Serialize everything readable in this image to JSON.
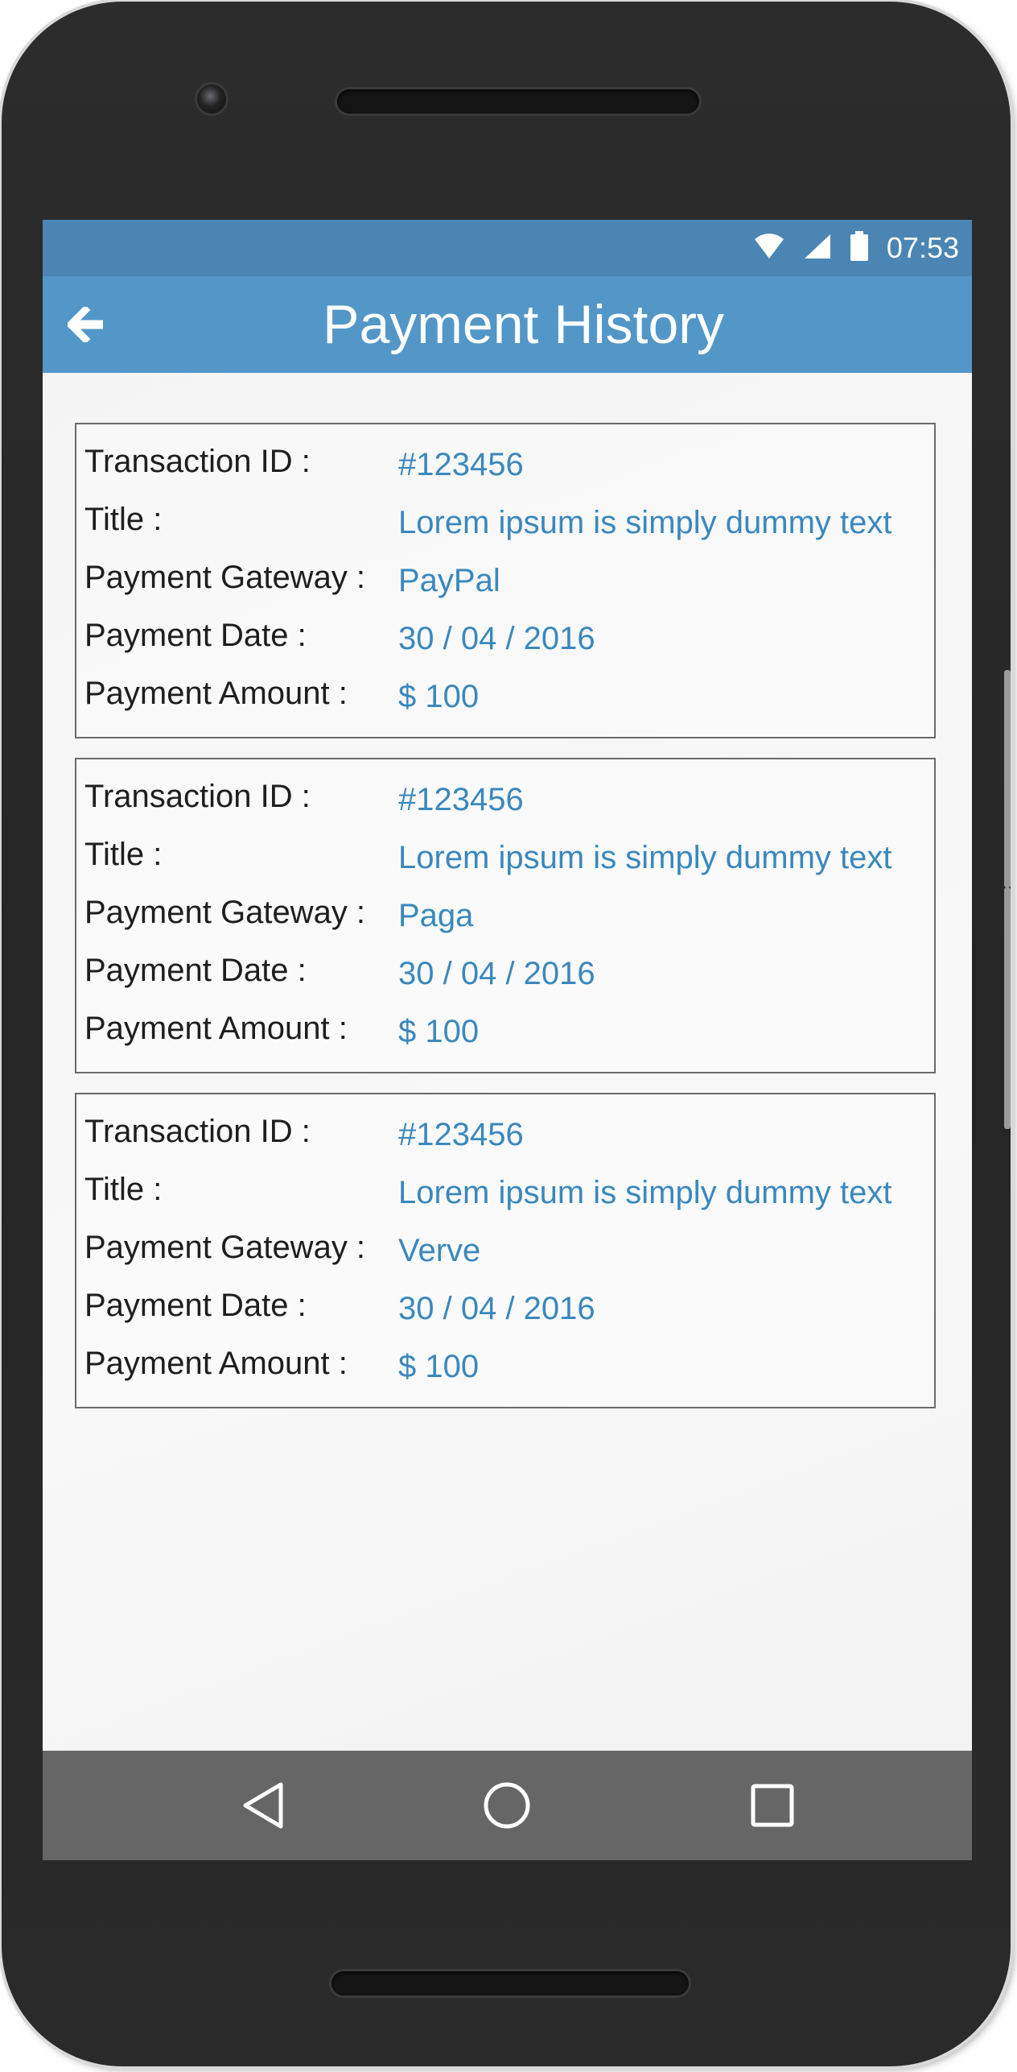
{
  "status_bar": {
    "time": "07:53",
    "icons": [
      "wifi-icon",
      "signal-icon",
      "battery-icon"
    ]
  },
  "app_bar": {
    "title": "Payment History",
    "back_icon": "arrow-back-icon"
  },
  "colors": {
    "status_bar": "#4a85b3",
    "app_bar": "#5297c7",
    "value_text": "#3a88bd",
    "nav_bar": "#666666"
  },
  "labels": {
    "transaction_id": "Transaction ID :",
    "title": "Title :",
    "gateway": "Payment Gateway :",
    "date": "Payment Date :",
    "amount": "Payment Amount :"
  },
  "payments": [
    {
      "transaction_id": "#123456",
      "title": "Lorem ipsum is simply dummy text",
      "gateway": "PayPal",
      "date": "30 / 04 / 2016",
      "amount": "$ 100"
    },
    {
      "transaction_id": "#123456",
      "title": "Lorem ipsum is simply dummy text",
      "gateway": "Paga",
      "date": "30 / 04 / 2016",
      "amount": "$ 100"
    },
    {
      "transaction_id": "#123456",
      "title": "Lorem ipsum is simply dummy text",
      "gateway": "Verve",
      "date": "30 / 04 / 2016",
      "amount": "$ 100"
    }
  ],
  "nav_bar": {
    "buttons": [
      "back-triangle-icon",
      "home-circle-icon",
      "recents-square-icon"
    ]
  }
}
